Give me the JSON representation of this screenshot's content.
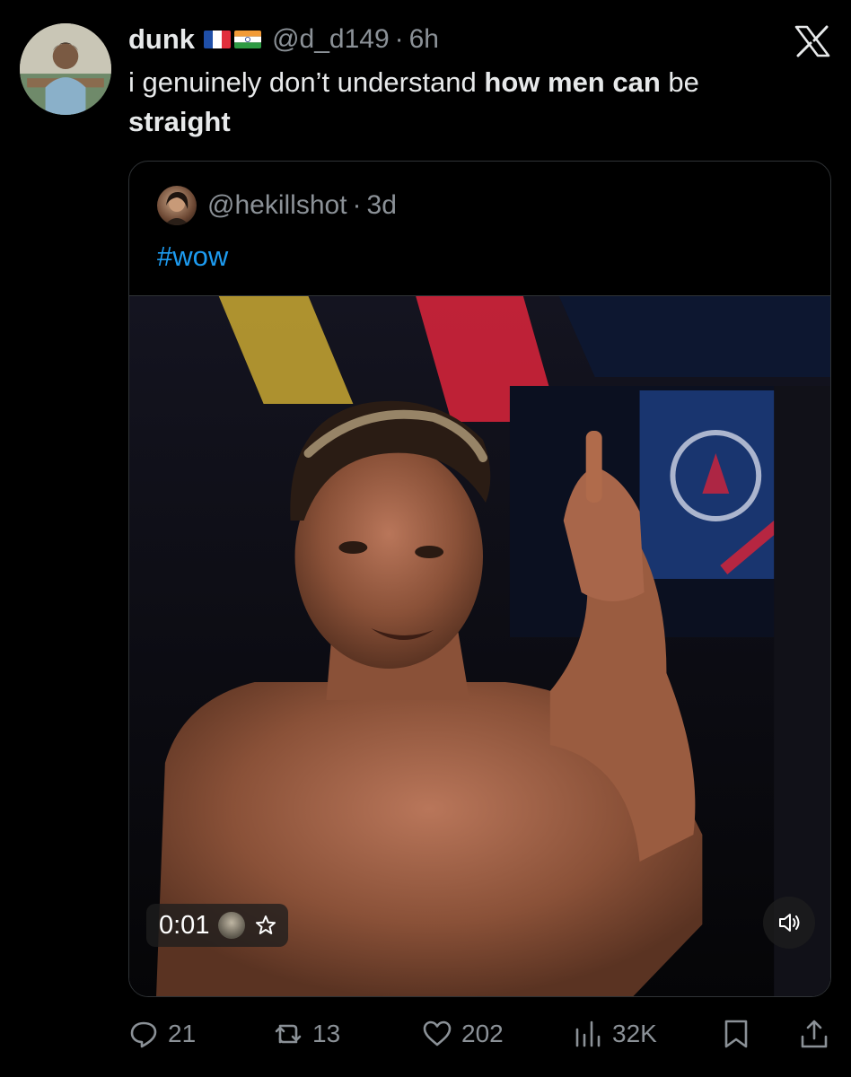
{
  "tweet": {
    "display_name": "dunk",
    "flags": [
      "france-flag-icon",
      "india-flag-icon"
    ],
    "handle": "@d_d149",
    "separator": "·",
    "time": "6h",
    "text_parts": [
      {
        "text": "i genuinely don’t understand ",
        "bold": false
      },
      {
        "text": "how men can",
        "bold": true
      },
      {
        "text": " be ",
        "bold": false
      },
      {
        "text": "straight",
        "bold": true
      }
    ]
  },
  "quote": {
    "handle": "@hekillshot",
    "separator": "·",
    "time": "3d",
    "hashtag": "#wow",
    "video": {
      "duration": "0:01",
      "icons": [
        "avatar-icon",
        "star-icon",
        "volume-icon"
      ]
    }
  },
  "actions": {
    "replies": "21",
    "retweets": "13",
    "likes": "202",
    "views": "32K"
  },
  "colors": {
    "background": "#000000",
    "text": "#e7e9ea",
    "muted": "#8b9197",
    "link": "#1d9bf0",
    "border": "#2f3336"
  }
}
